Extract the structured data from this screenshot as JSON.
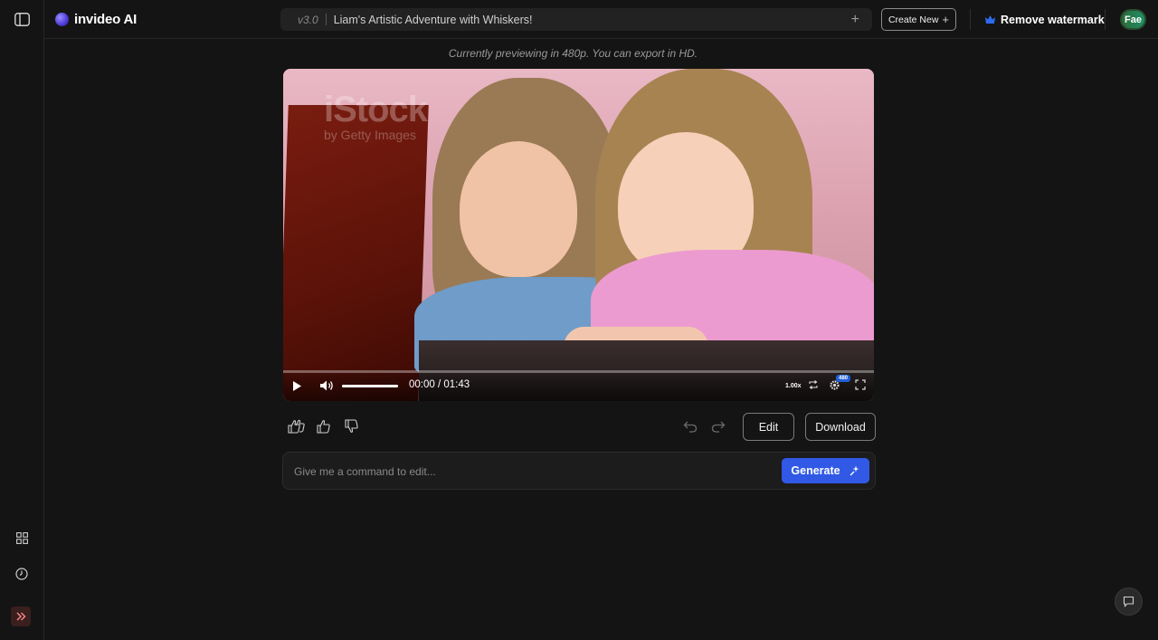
{
  "app": {
    "brand": "invideo AI"
  },
  "header": {
    "version": "v3.0",
    "project_title": "Liam's Artistic Adventure with Whiskers!",
    "create_new_label": "Create New",
    "remove_watermark_label": "Remove watermark",
    "avatar_initials": "Fae"
  },
  "preview": {
    "notice": "Currently previewing in 480p. You can export in HD.",
    "watermark_main": "iStock",
    "watermark_sub": "by Getty Images",
    "timecode": "00:00 / 01:43",
    "speed": "1.00x",
    "quality_badge": "480",
    "progress": 0.0,
    "volume": 1.0
  },
  "actions": {
    "edit_label": "Edit",
    "download_label": "Download"
  },
  "command": {
    "placeholder": "Give me a command to edit...",
    "generate_label": "Generate"
  },
  "icons": {
    "sidebar_toggle": "sidebar-panel-icon",
    "grid": "grid-icon",
    "history": "clock-icon",
    "expand": "double-chevron-right-icon",
    "chat": "chat-bubble-icon"
  },
  "colors": {
    "background": "#141414",
    "accent": "#3159e6",
    "crown": "#2f6bf0"
  }
}
